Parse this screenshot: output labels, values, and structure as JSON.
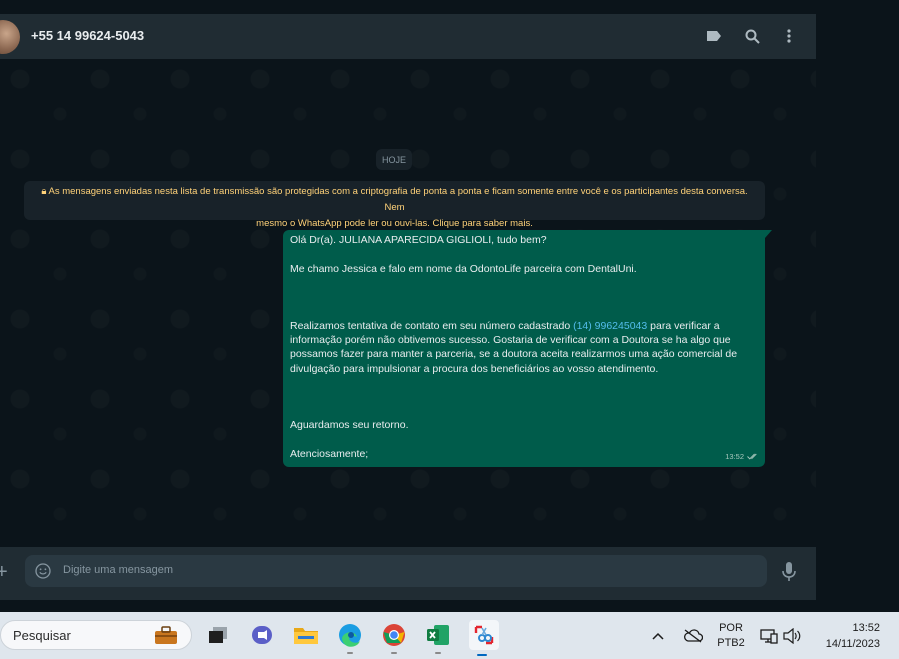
{
  "header": {
    "contact_name": "+55 14 99624-5043",
    "icons": [
      "label-icon",
      "search-icon",
      "menu-icon"
    ]
  },
  "chat": {
    "date_chip": "HOJE",
    "encryption_notice": {
      "line1": "As mensagens enviadas nesta lista de transmissão são protegidas com a criptografia de ponta a ponta e ficam somente entre você e os participantes desta conversa. Nem",
      "line2": "mesmo o WhatsApp pode ler ou ouvi-las. Clique para saber mais."
    },
    "message": {
      "greeting": "Olá Dr(a). JULIANA APARECIDA GIGLIOLI, tudo bem?",
      "intro": "Me chamo Jessica e falo em nome da OdontoLife parceira com DentalUni.",
      "body_before_link": "Realizamos tentativa de contato em seu número cadastrado ",
      "phone_link": "(14) 996245043",
      "body_after_link": " para verificar a informação porém não obtivemos sucesso. Gostaria de verificar com a Doutora se ha algo que possamos fazer para manter a parceria, se a doutora aceita realizarmos uma ação comercial de divulgação para impulsionar a procura dos beneficiários ao vosso atendimento.",
      "closing1": "Aguardamos seu retorno.",
      "closing2": "Atenciosamente;",
      "time": "13:52",
      "status": "read-double-check"
    }
  },
  "footer": {
    "input_placeholder": "Digite uma mensagem"
  },
  "taskbar": {
    "search_placeholder": "Pesquisar",
    "apps": [
      "briefcase-icon",
      "task-view-icon",
      "teams-icon",
      "file-explorer-icon",
      "edge-icon",
      "chrome-icon",
      "excel-icon",
      "snipping-tool-icon"
    ],
    "language_line1": "POR",
    "language_line2": "PTB2",
    "time": "13:52",
    "date": "14/11/2023"
  },
  "colors": {
    "outgoing_bubble": "#005c4b",
    "notice_text": "#ffd279",
    "link": "#53bdeb",
    "header_bg": "#202c33"
  }
}
